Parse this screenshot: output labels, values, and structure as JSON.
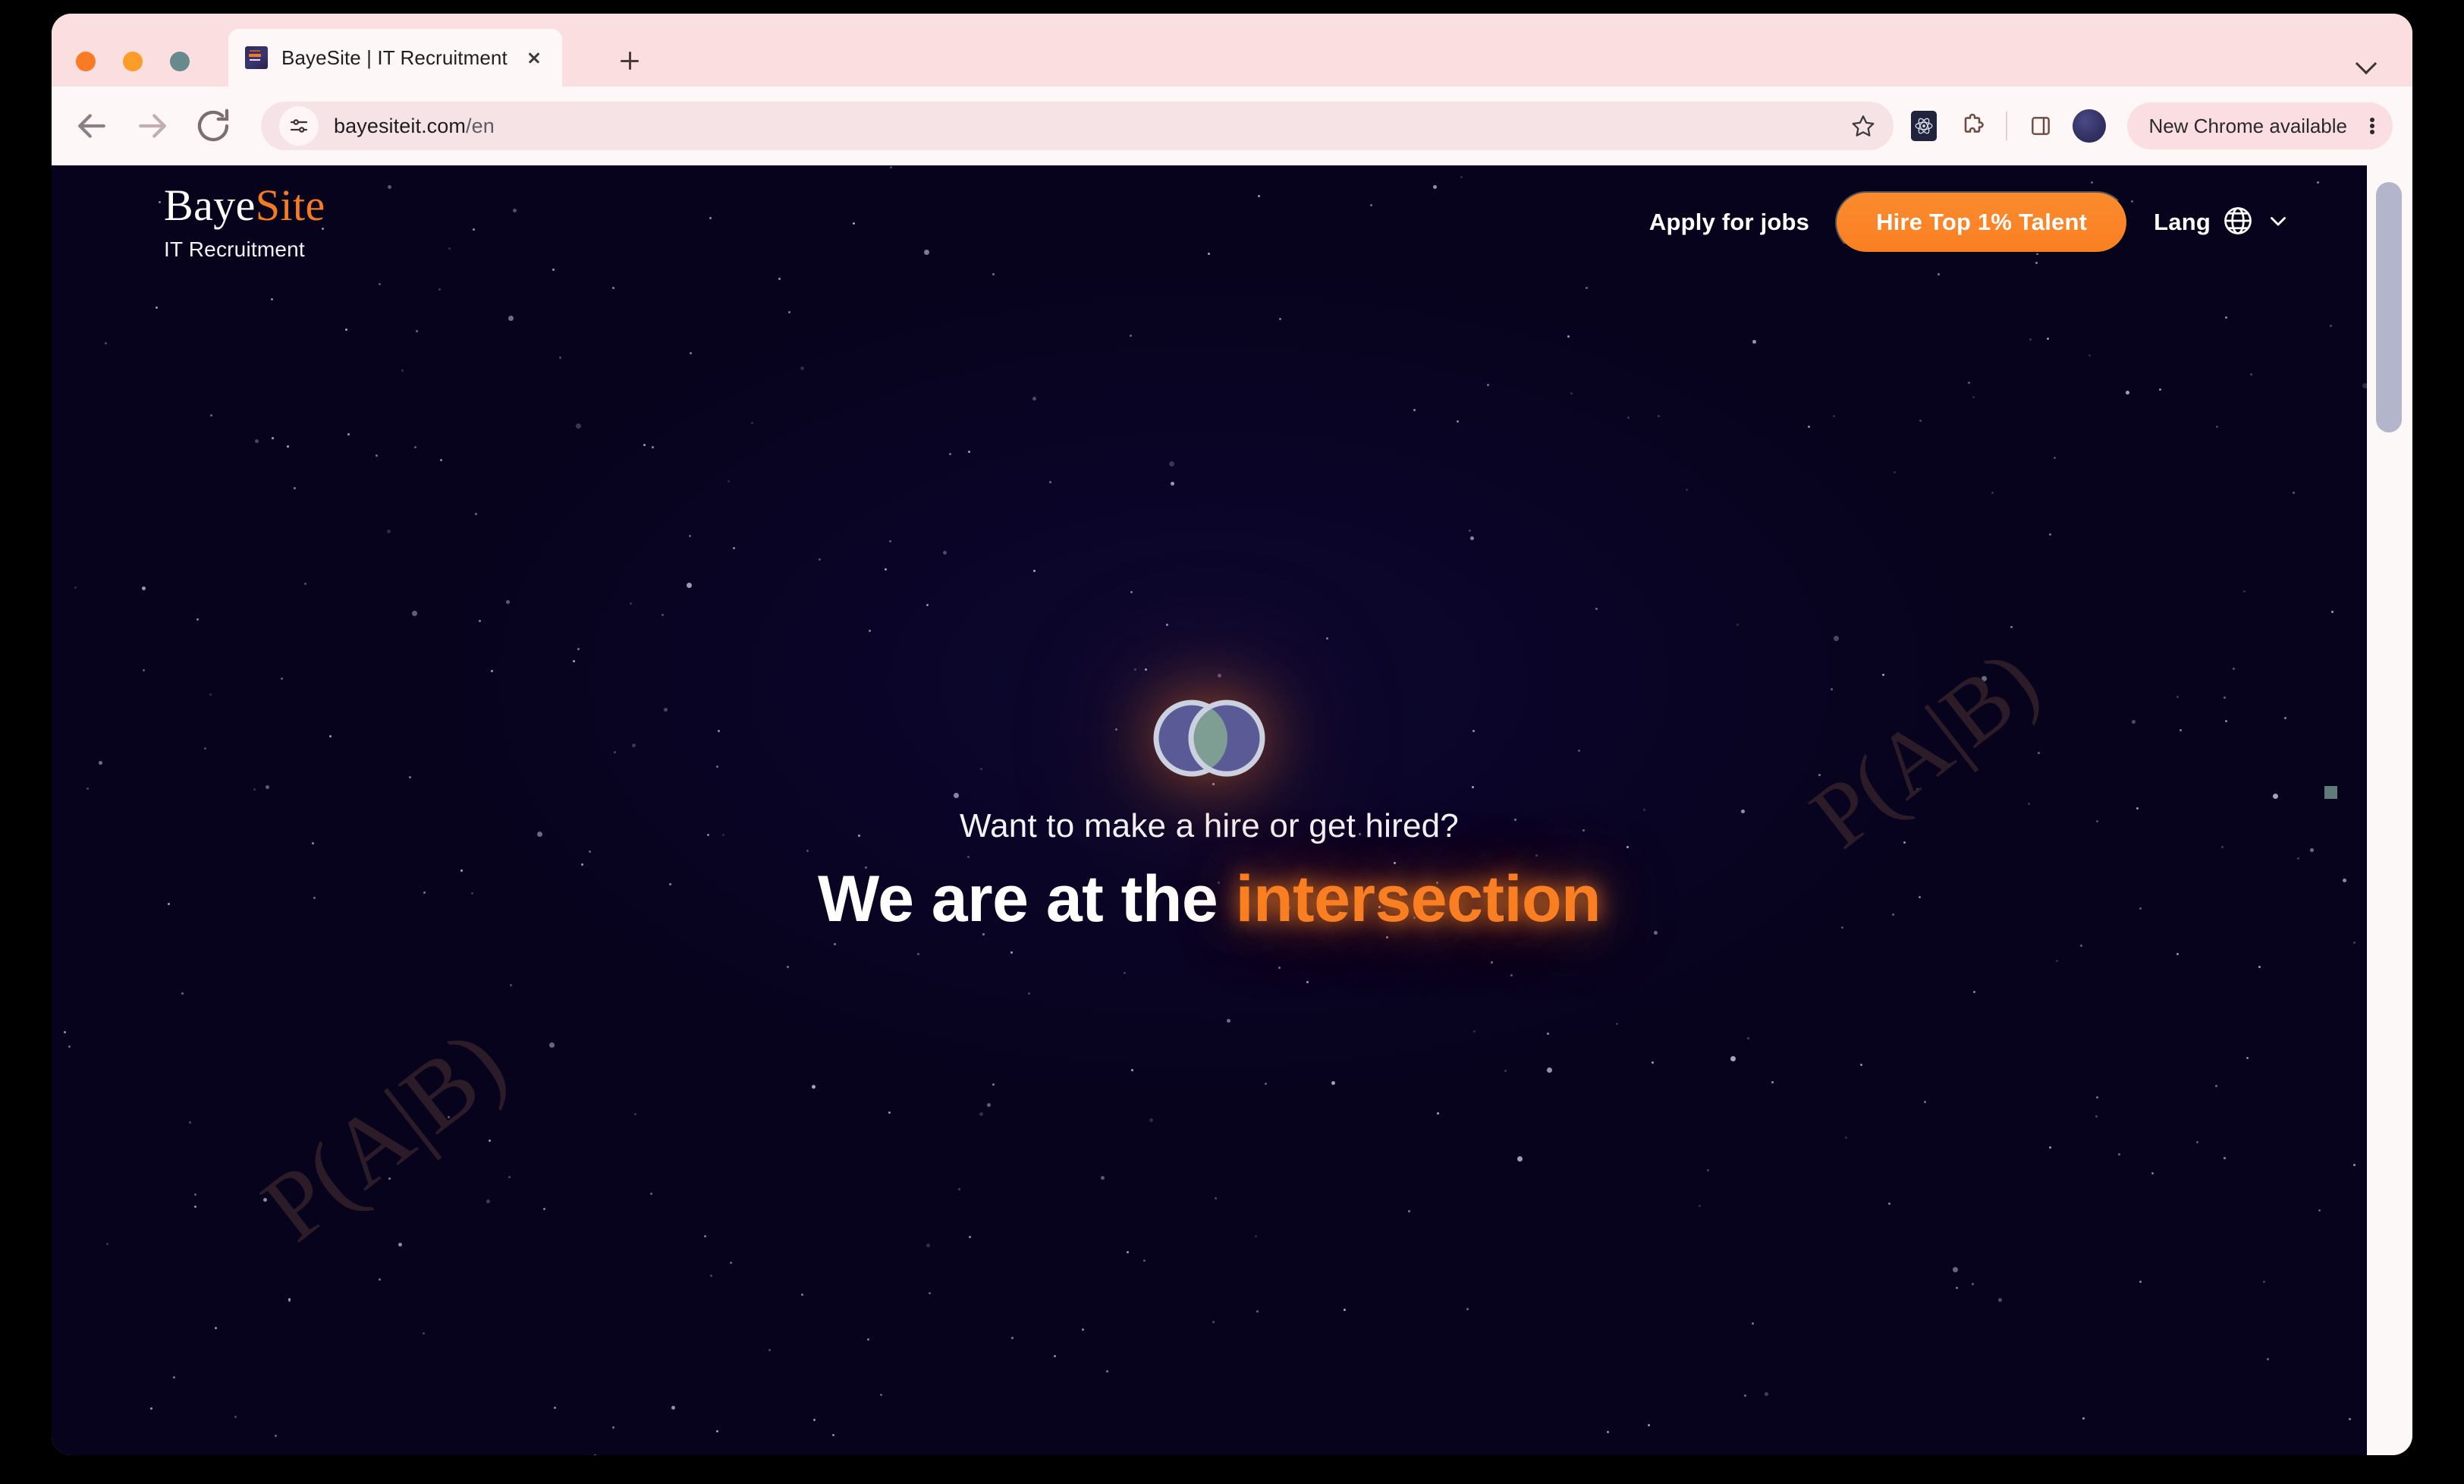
{
  "browser": {
    "window_controls": [
      {
        "name": "close",
        "color": "#fb7a24"
      },
      {
        "name": "minimize",
        "color": "#fb9d28"
      },
      {
        "name": "maximize",
        "color": "#678a8c"
      }
    ],
    "tab": {
      "title": "BayeSite | IT Recruitment",
      "favicon_name": "bayesite-favicon",
      "close_label": "",
      "new_tab_label": ""
    },
    "toolbar": {
      "back_icon": "back-arrow-icon",
      "forward_icon": "forward-arrow-icon",
      "reload_icon": "reload-icon",
      "site_settings_icon": "tune-icon",
      "url_domain": "bayesiteit.com",
      "url_path": "/en",
      "bookmark_icon": "star-outline-icon",
      "react_devtools_icon": "react-atom-icon",
      "extensions_icon": "puzzle-piece-icon",
      "side_panel_icon": "side-panel-icon",
      "profile_icon": "profile-avatar",
      "update_pill_label": "New Chrome available",
      "menu_icon": "three-dot-menu-icon"
    }
  },
  "site": {
    "logo": {
      "word_primary": "Baye",
      "word_accent": "Site",
      "tagline": "IT Recruitment"
    },
    "nav": {
      "apply_label": "Apply for jobs",
      "hire_label": "Hire Top 1% Talent",
      "lang_label": "Lang",
      "globe_icon": "globe-icon",
      "chevron_icon": "chevron-down-icon"
    },
    "hero": {
      "venn_icon": "venn-diagram-logo",
      "eyebrow": "Want to make a hire or get hired?",
      "headline_plain": "We are at the ",
      "headline_accent": "intersection"
    },
    "watermarks": [
      "P(A|B)",
      "P(A|B)"
    ],
    "colors": {
      "brand_orange": "#f97f22",
      "page_background": "#07031d",
      "chrome_background": "#fbdfe0",
      "venn_fill": "#5a5a96",
      "venn_intersection": "#7e9d93",
      "accent_square": "#6d8f8a"
    }
  }
}
